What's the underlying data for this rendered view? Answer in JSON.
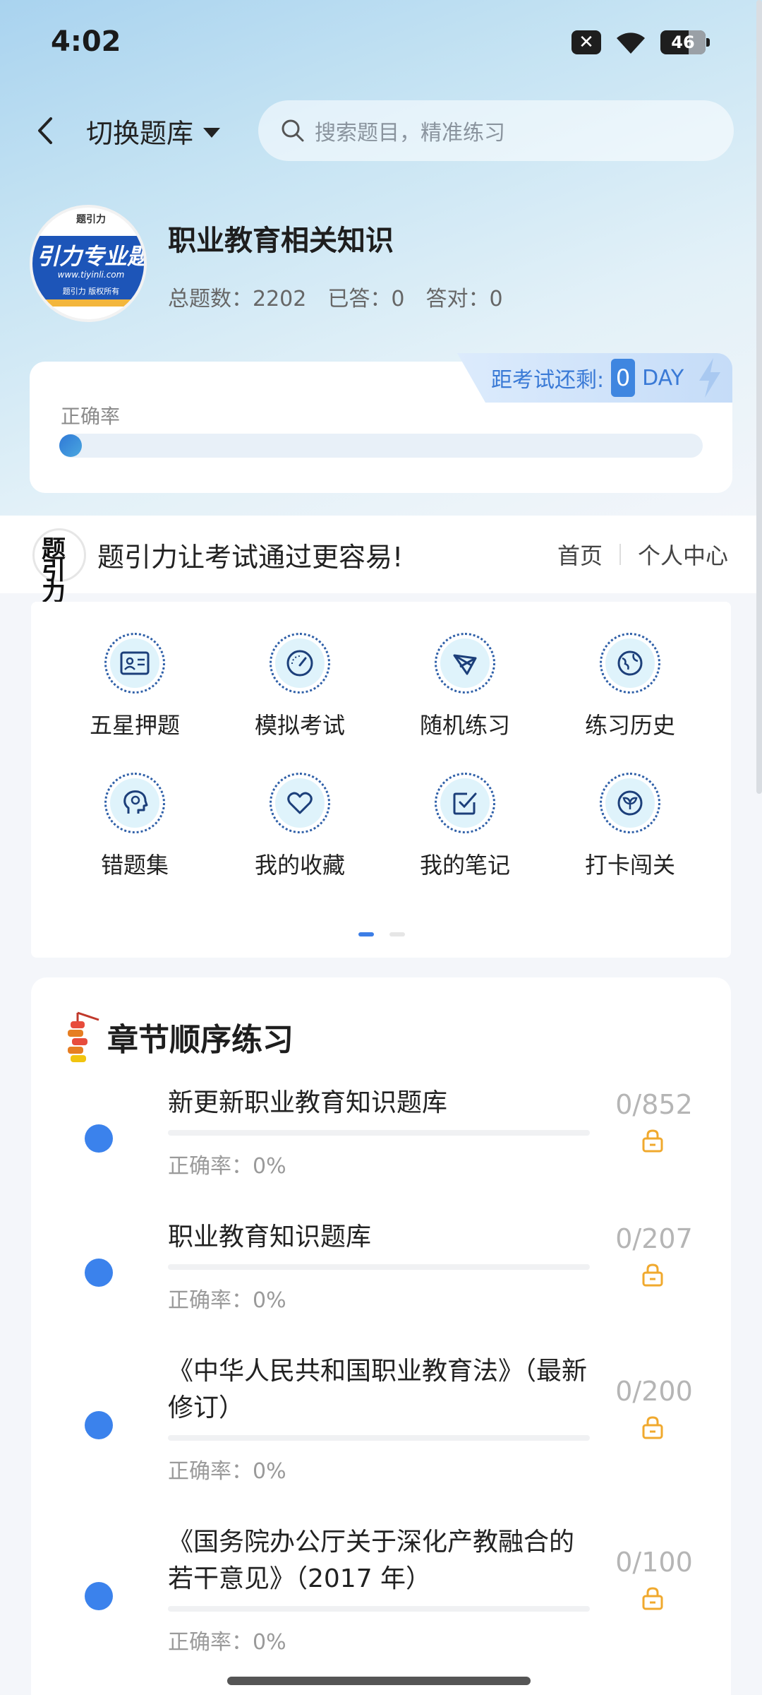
{
  "status_bar": {
    "time": "4:02",
    "battery": "46"
  },
  "header": {
    "switch_label": "切换题库",
    "search_placeholder": "搜索题目，精准练习"
  },
  "subject": {
    "logo_top": "题引力",
    "logo_main": "引力专业题",
    "logo_url": "www.tiyinli.com",
    "logo_foot": "题引力 版权所有",
    "title": "职业教育相关知识",
    "total": "总题数：2202",
    "answered": "已答：0",
    "correct": "答对：0"
  },
  "accuracy": {
    "label": "正确率",
    "fraction": 0.0,
    "countdown_label": "距考试还剩:",
    "countdown_value": "0",
    "countdown_unit": "DAY"
  },
  "brand": {
    "slogan": "题引力让考试通过更容易!",
    "nav_home": "首页",
    "nav_profile": "个人中心"
  },
  "functions": [
    {
      "label": "五星押题",
      "icon": "id-card-icon"
    },
    {
      "label": "模拟考试",
      "icon": "speedometer-icon"
    },
    {
      "label": "随机练习",
      "icon": "shuffle-icon"
    },
    {
      "label": "练习历史",
      "icon": "globe-icon"
    },
    {
      "label": "错题集",
      "icon": "head-icon"
    },
    {
      "label": "我的收藏",
      "icon": "heart-icon"
    },
    {
      "label": "我的笔记",
      "icon": "checkbox-icon"
    },
    {
      "label": "打卡闯关",
      "icon": "leaf-icon"
    }
  ],
  "chapters": {
    "title": "章节顺序练习",
    "items": [
      {
        "name": "新更新职业教育知识题库",
        "accuracy": "正确率：0%",
        "count": "0/852"
      },
      {
        "name": "职业教育知识题库",
        "accuracy": "正确率：0%",
        "count": "0/207"
      },
      {
        "name": "《中华人民共和国职业教育法》（最新修订）",
        "accuracy": "正确率：0%",
        "count": "0/200"
      },
      {
        "name": "《国务院办公厅关于深化产教融合的若干意见》（2017 年）",
        "accuracy": "正确率：0%",
        "count": "0/100"
      }
    ]
  },
  "colors": {
    "accent": "#3b82ec",
    "lock": "#f0a92e"
  }
}
